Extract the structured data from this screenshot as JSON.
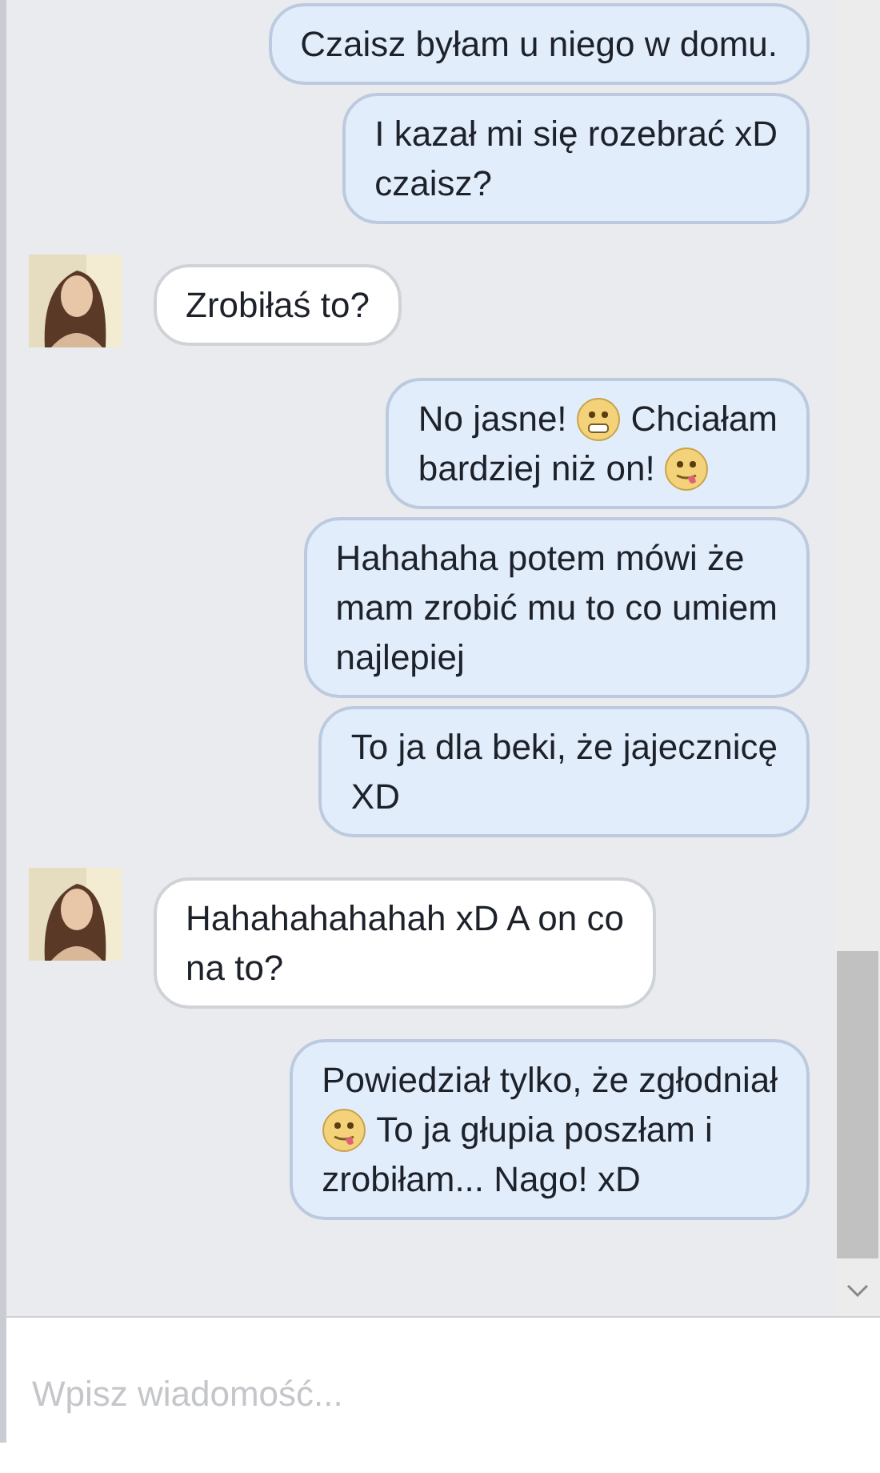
{
  "messages": [
    {
      "kind": "sent",
      "lines": [
        [
          {
            "kind": "text",
            "text": "Czaisz byłam u niego w domu."
          }
        ]
      ]
    },
    {
      "kind": "sent",
      "lines": [
        [
          {
            "kind": "text",
            "text": "I kazał mi się rozebrać xD"
          }
        ],
        [
          {
            "kind": "text",
            "text": "czaisz?"
          }
        ]
      ]
    },
    {
      "kind": "received",
      "lines": [
        [
          {
            "kind": "text",
            "text": "Zrobiłaś to?"
          }
        ]
      ]
    },
    {
      "kind": "sent",
      "lines": [
        [
          {
            "kind": "text",
            "text": "No jasne!"
          },
          {
            "kind": "grin"
          },
          {
            "kind": "text",
            "text": "Chciałam"
          }
        ],
        [
          {
            "kind": "text",
            "text": "bardziej niż on!"
          },
          {
            "kind": "tongue"
          }
        ]
      ]
    },
    {
      "kind": "sent",
      "lines": [
        [
          {
            "kind": "text",
            "text": "Hahahaha potem mówi że"
          }
        ],
        [
          {
            "kind": "text",
            "text": "mam zrobić mu to co umiem"
          }
        ],
        [
          {
            "kind": "text",
            "text": "najlepiej"
          }
        ]
      ]
    },
    {
      "kind": "sent",
      "lines": [
        [
          {
            "kind": "text",
            "text": "To ja dla beki, że jajecznicę"
          }
        ],
        [
          {
            "kind": "text",
            "text": "XD"
          }
        ]
      ]
    },
    {
      "kind": "received",
      "lines": [
        [
          {
            "kind": "text",
            "text": "Hahahahahahah xD A on co"
          }
        ],
        [
          {
            "kind": "text",
            "text": "na to?"
          }
        ]
      ]
    },
    {
      "kind": "sent",
      "lines": [
        [
          {
            "kind": "text",
            "text": "Powiedział tylko, że zgłodniał"
          }
        ],
        [
          {
            "kind": "tongue"
          },
          {
            "kind": "text",
            "text": "To ja głupia poszłam i"
          }
        ],
        [
          {
            "kind": "text",
            "text": "zrobiłam... Nago! xD"
          }
        ]
      ]
    }
  ],
  "composer": {
    "placeholder": "Wpisz wiadomość..."
  }
}
